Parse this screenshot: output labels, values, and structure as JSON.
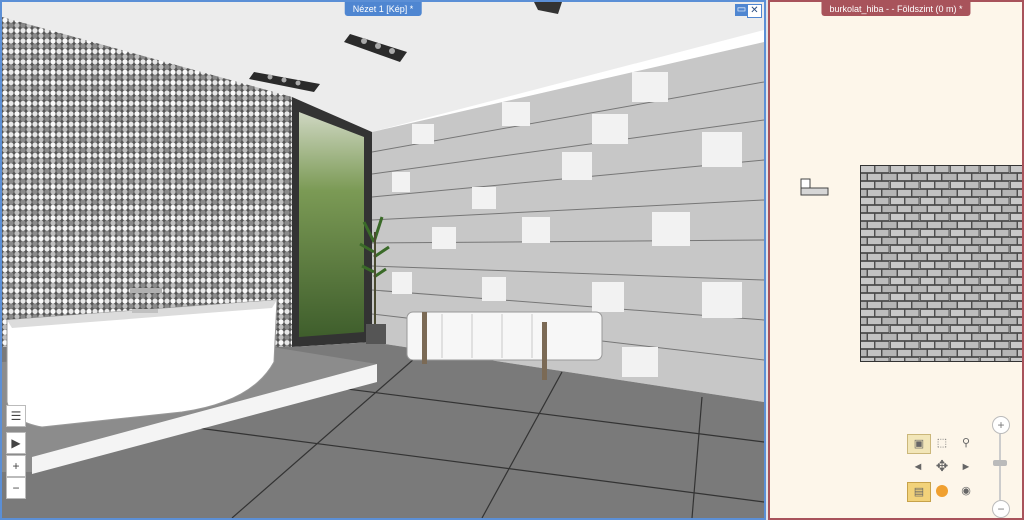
{
  "view3d": {
    "title": "Nézet 1 [Kép] *",
    "restore_symbol": "▭",
    "close_symbol": "✕"
  },
  "view2d": {
    "title": "burkolat_hiba -  - Földszint (0 m) *"
  },
  "side_toolbar": {
    "list_icon": "☰",
    "expand_icon": "▶",
    "zoom_in": "+",
    "zoom_out": "−"
  },
  "nav_widget": {
    "zoom_in": "+",
    "zoom_out": "−",
    "left": "◄",
    "right": "►",
    "up": "▲",
    "down": "▼"
  },
  "icons": {
    "list": "list-icon",
    "expand": "chevron-right-icon",
    "zoom_in": "plus-icon",
    "zoom_out": "minus-icon",
    "move": "move-cross-icon",
    "eye": "eye-icon"
  },
  "colors": {
    "accent3d": "#4f86d1",
    "accent2d": "#a8535b",
    "plan_bg": "#fdf6ea"
  }
}
